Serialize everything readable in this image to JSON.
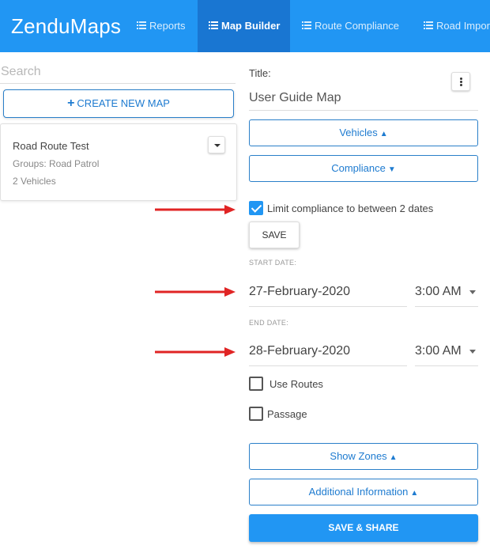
{
  "navbar": {
    "brand": "ZenduMaps",
    "items": [
      {
        "label": "Reports",
        "icon": "list-icon",
        "active": false
      },
      {
        "label": "Map Builder",
        "icon": "list-icon",
        "active": true
      },
      {
        "label": "Route Compliance",
        "icon": "list-icon",
        "active": false
      },
      {
        "label": "Road Impor",
        "icon": "list-icon",
        "active": false
      }
    ]
  },
  "sidebar": {
    "search_placeholder": "Search",
    "create_button": "CREATE NEW MAP",
    "map_card": {
      "name": "Road Route Test",
      "groups": "Groups: Road Patrol",
      "vehicles": "2 Vehicles"
    }
  },
  "builder": {
    "title_label": "Title:",
    "title_value": "User Guide Map",
    "vehicles_button": "Vehicles",
    "compliance_button": "Compliance",
    "limit_compliance": {
      "label": "Limit compliance to between 2 dates",
      "checked": true
    },
    "save_button": "SAVE",
    "start_date_label": "START DATE:",
    "start_date": "27-February-2020",
    "start_time": "3:00 AM",
    "end_date_label": "END DATE:",
    "end_date": "28-February-2020",
    "end_time": "3:00 AM",
    "use_routes": {
      "label": "Use Routes",
      "checked": false
    },
    "passage": {
      "label": "Passage",
      "checked": false
    },
    "show_zones_button": "Show Zones",
    "additional_info_button": "Additional Information",
    "save_share_button": "SAVE & SHARE"
  },
  "colors": {
    "primary": "#2196f3",
    "primary_dark": "#1976d2",
    "annotation_arrow": "#e02424"
  }
}
